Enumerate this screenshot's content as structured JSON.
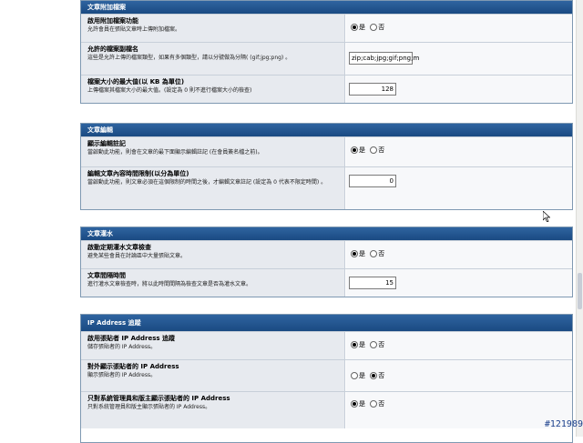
{
  "attachments": {
    "title": "文章附加檔案",
    "rows": [
      {
        "title": "啟用附加檔案功能",
        "desc": "允許會員在張貼文章時上傳附加檔案。",
        "yes": "是",
        "no": "否",
        "selected": "yes"
      },
      {
        "title": "允許的檔案副檔名",
        "desc": "這些是允許上傳的檔案類型，如果有多個類型，請以分號做為分隔( (gif;jpg;png) 。",
        "value": "zip;cab;jpg;gif;png;m"
      },
      {
        "title": "檔案大小的最大值(以 KB 為單位)",
        "desc": "上傳檔案其檔案大小的最大值。(設定為 0 則不進行檔案大小的檢查)",
        "value": "128"
      }
    ]
  },
  "editing": {
    "title": "文章編輯",
    "rows": [
      {
        "title": "顯示編輯註記",
        "desc": "當啟動此功能，則會在文章的最下面顯示編輯註記 (在會員簽名檔之前)。",
        "yes": "是",
        "no": "否",
        "selected": "yes"
      },
      {
        "title": "編輯文章內容時間限制(以分為單位)",
        "desc": "當啟動此功能，則文章必須在這個限制的時間之後，才編輯文章註記 (設定為 0 代表不限定時間) 。",
        "value": "0"
      }
    ]
  },
  "flood": {
    "title": "文章灌水",
    "rows": [
      {
        "title": "啟動定期灌水文章檢查",
        "desc": "避免某些會員在討論區中大量張貼文章。",
        "yes": "是",
        "no": "否",
        "selected": "yes"
      },
      {
        "title": "文章間隔時間",
        "desc": "進行灌水文章檢查時，將以此時間間隔為檢查文章是否為灌水文章。",
        "value": "15"
      }
    ]
  },
  "ip": {
    "title": "IP Address 追蹤",
    "rows": [
      {
        "title": "啟用張貼者 IP Address 追蹤",
        "desc": "儲存張貼者的 IP Address。",
        "yes": "是",
        "no": "否",
        "selected": "yes"
      },
      {
        "title": "對外顯示張貼者的 IP Address",
        "desc": "顯示張貼者的 IP Address。",
        "yes": "是",
        "no": "否",
        "selected": "no"
      },
      {
        "title": "只對系統管理員和版主顯示張貼者的 IP Address",
        "desc": "只對系統管理員和版主顯示張貼者的 IP Address。",
        "yes": "是",
        "no": "否",
        "selected": "yes"
      }
    ]
  },
  "watermark": "#121989",
  "colors": {
    "header": "#1a4a82",
    "label_bg": "#e7eaef",
    "border": "#7f99b2"
  }
}
